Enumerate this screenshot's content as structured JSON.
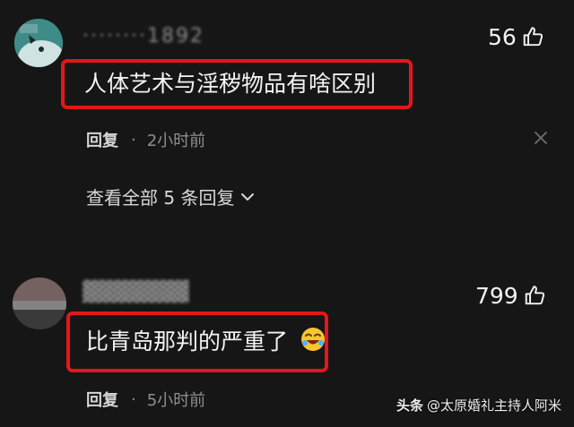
{
  "comments": [
    {
      "username": "········1892",
      "likes": "56",
      "text": "人体艺术与淫秽物品有啥区别",
      "reply_label": "回复",
      "separator": "·",
      "time": "2小时前",
      "view_replies": "查看全部 5 条回复"
    },
    {
      "username": "▓▓▓▓▓▓▓",
      "likes": "799",
      "text": "比青岛那判的严重了",
      "reply_label": "回复",
      "separator": "·",
      "time": "5小时前"
    }
  ],
  "watermark": {
    "brand": "头条",
    "account": "@太原婚礼主持人阿米"
  },
  "colors": {
    "background": "#161616",
    "highlight_border": "#e4161c",
    "avatar1": "#3f8b88"
  }
}
